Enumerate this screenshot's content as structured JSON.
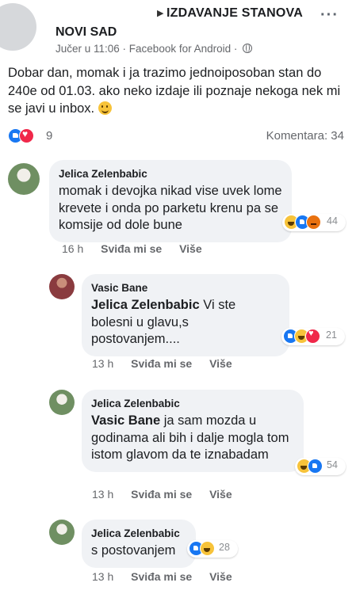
{
  "post": {
    "author": "NOVI SAD",
    "group": "IZDAVANJE STANOVA",
    "meta": "Jučer u 11:06 · Facebook for Android ·",
    "text": "Dobar dan, momak i ja trazimo jednoiposoban stan do 240e od 01.03. ako neko izdaje ili poznaje nekoga nek mi se javi u inbox.",
    "reaction_count": "9",
    "comments_label": "Komentara: 34"
  },
  "comments": [
    {
      "author": "Jelica Zelenbabic",
      "mention": "",
      "text": "momak i devojka nikad vise uvek lome krevete i onda po parketu krenu pa se komsije od dole bune",
      "reactions": [
        "haha",
        "like",
        "angry"
      ],
      "reaction_count": "44",
      "time": "16 h",
      "like_label": "Sviđa mi se",
      "more_label": "Više"
    },
    {
      "author": "Vasic Bane",
      "mention": "Jelica Zelenbabic",
      "text": "Vi ste bolesni u glavu,s postovanjem....",
      "reactions": [
        "like",
        "haha",
        "love"
      ],
      "reaction_count": "21",
      "time": "13 h",
      "like_label": "Sviđa mi se",
      "more_label": "Više"
    },
    {
      "author": "Jelica Zelenbabic",
      "mention": "Vasic Bane",
      "text": "ja sam mozda u godinama ali bih i dalje mogla tom istom glavom da te iznabadam",
      "reactions": [
        "haha",
        "like"
      ],
      "reaction_count": "54",
      "time": "13 h",
      "like_label": "Sviđa mi se",
      "more_label": "Više"
    },
    {
      "author": "Jelica Zelenbabic",
      "mention": "",
      "text": "s postovanjem",
      "reactions": [
        "like",
        "haha"
      ],
      "reaction_count": "28",
      "time": "13 h",
      "like_label": "Sviđa mi se",
      "more_label": "Više"
    }
  ],
  "colors": {
    "bubble": "#f0f2f5",
    "meta_text": "#65676b",
    "like_blue": "#1877f2",
    "love_red": "#f0284a",
    "haha_yellow": "#f7c33a",
    "angry_orange": "#e9710f"
  },
  "icons": {
    "globe": "globe-icon",
    "more": "more-dots-icon",
    "group_arrow": "triangle-right-icon",
    "emoji": "smile-emoji-icon"
  }
}
